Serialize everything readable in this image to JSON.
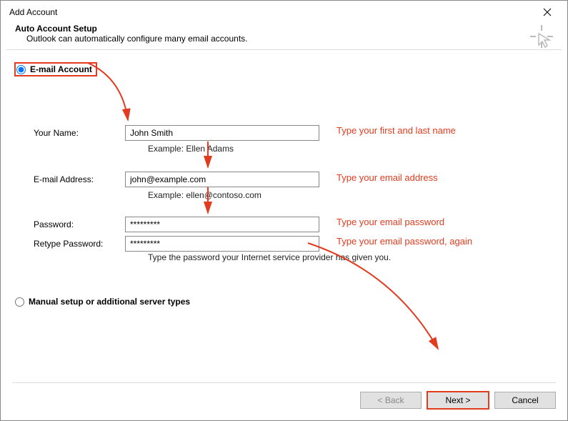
{
  "window": {
    "title": "Add Account"
  },
  "header": {
    "title": "Auto Account Setup",
    "subtitle": "Outlook can automatically configure many email accounts."
  },
  "radios": {
    "email_account": "E-mail Account",
    "manual": "Manual setup or additional server types"
  },
  "fields": {
    "name": {
      "label": "Your Name:",
      "value": "John Smith",
      "example": "Example: Ellen Adams",
      "hint": "Type your first and last name"
    },
    "email": {
      "label": "E-mail Address:",
      "value": "john@example.com",
      "example": "Example: ellen@contoso.com",
      "hint": "Type your email address"
    },
    "pw": {
      "label": "Password:",
      "value": "*********",
      "hint": "Type your email password"
    },
    "pw2": {
      "label": "Retype Password:",
      "value": "*********",
      "hint": "Type your email password, again"
    },
    "pw_note": "Type the password your Internet service provider has given you."
  },
  "buttons": {
    "back": "< Back",
    "next": "Next >",
    "cancel": "Cancel"
  }
}
